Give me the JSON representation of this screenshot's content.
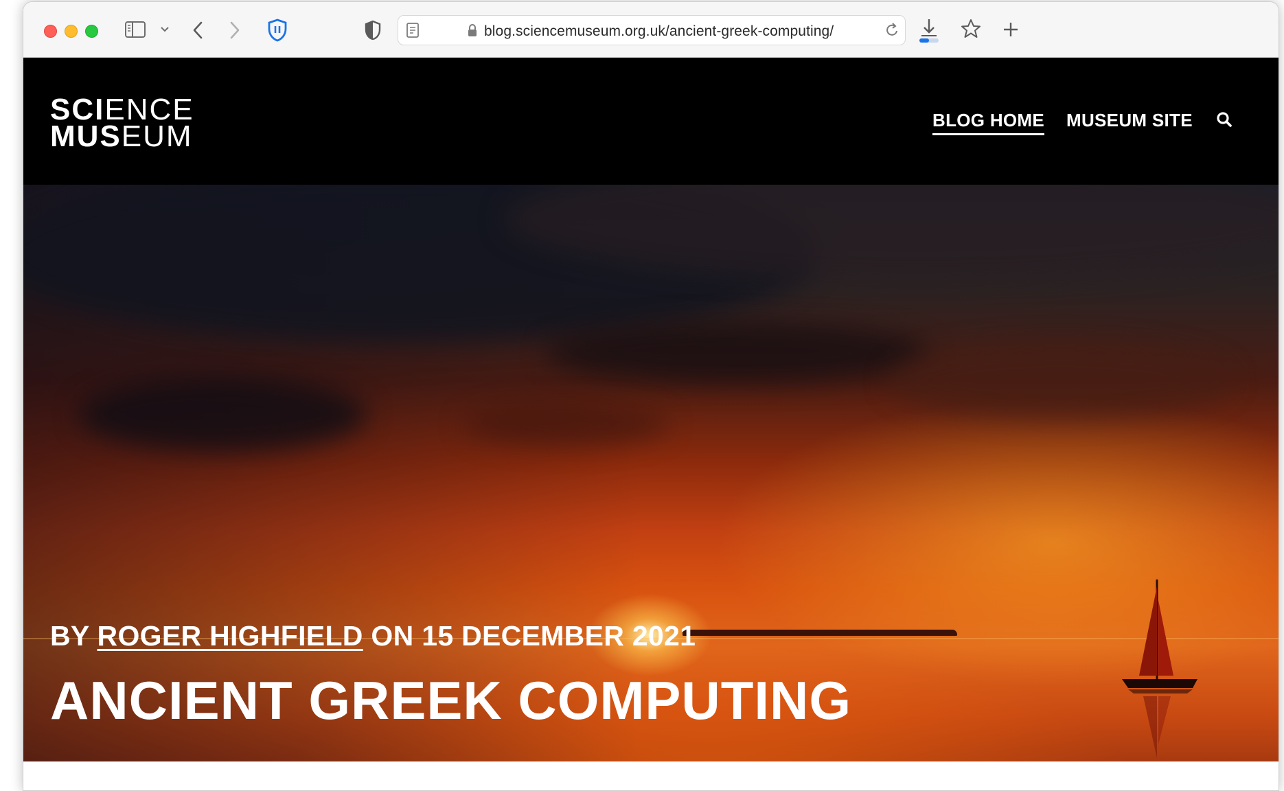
{
  "browser": {
    "url": "blog.sciencemuseum.org.uk/ancient-greek-computing/"
  },
  "site": {
    "logo_line1_bold": "SCI",
    "logo_line1_thin": "ENCE",
    "logo_line2_bold": "MUS",
    "logo_line2_thin": "EUM",
    "nav": [
      {
        "label": "BLOG HOME",
        "active": true
      },
      {
        "label": "MUSEUM SITE",
        "active": false
      }
    ]
  },
  "article": {
    "by_prefix": "BY",
    "author": "ROGER HIGHFIELD",
    "date_text": "ON 15 DECEMBER 2021",
    "title": "ANCIENT GREEK COMPUTING"
  },
  "icons": [
    "sidebar-icon",
    "chevron-down-icon",
    "back-icon",
    "forward-icon",
    "shield-extension-icon",
    "privacy-shield-icon",
    "reader-icon",
    "lock-icon",
    "reload-icon",
    "download-icon",
    "star-icon",
    "plus-icon",
    "search-icon"
  ],
  "colors": {
    "header_bg": "#000000",
    "hero_sunset": "#d8520f"
  }
}
